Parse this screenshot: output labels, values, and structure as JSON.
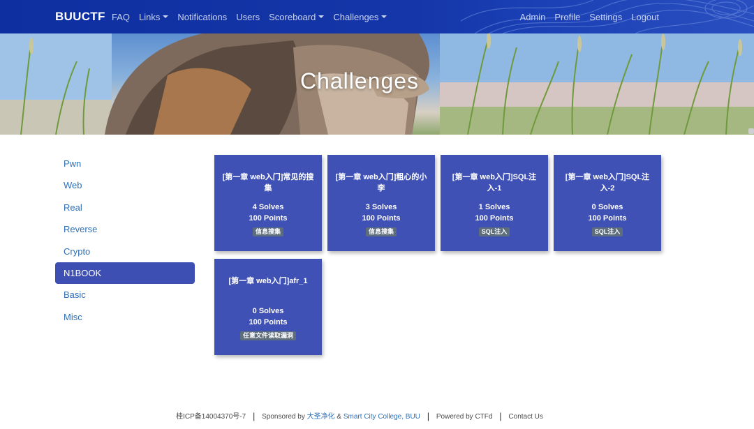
{
  "brand": "BUUCTF",
  "nav_left": [
    {
      "label": "FAQ",
      "dropdown": false
    },
    {
      "label": "Links",
      "dropdown": true
    },
    {
      "label": "Notifications",
      "dropdown": false
    },
    {
      "label": "Users",
      "dropdown": false
    },
    {
      "label": "Scoreboard",
      "dropdown": true
    },
    {
      "label": "Challenges",
      "dropdown": true
    }
  ],
  "nav_right": [
    "Admin",
    "Profile",
    "Settings",
    "Logout"
  ],
  "hero_title": "Challenges",
  "categories": [
    "Pwn",
    "Web",
    "Real",
    "Reverse",
    "Crypto",
    "N1BOOK",
    "Basic",
    "Misc"
  ],
  "active_category": "N1BOOK",
  "challenges": [
    {
      "name": "[第一章 web入门]常见的搜集",
      "solves": "4 Solves",
      "points": "100 Points",
      "tag": "信息搜集"
    },
    {
      "name": "[第一章 web入门]粗心的小李",
      "solves": "3 Solves",
      "points": "100 Points",
      "tag": "信息搜集"
    },
    {
      "name": "[第一章 web入门]SQL注入-1",
      "solves": "1 Solves",
      "points": "100 Points",
      "tag": "SQL注入"
    },
    {
      "name": "[第一章 web入门]SQL注入-2",
      "solves": "0 Solves",
      "points": "100 Points",
      "tag": "SQL注入"
    },
    {
      "name": "[第一章 web入门]afr_1",
      "solves": "0 Solves",
      "points": "100 Points",
      "tag": "任意文件读取漏洞"
    }
  ],
  "footer": {
    "icp": "桂ICP备14004370号-7",
    "sponsored_prefix": "Sponsored by",
    "sponsor1": "大圣净化",
    "amp": "&",
    "sponsor2": "Smart City College, BUU",
    "powered": "Powered by CTFd",
    "contact": "Contact Us"
  },
  "colors": {
    "navbar": "#1436a8",
    "card": "#3f51b5",
    "active_category": "#3d4fb3",
    "link": "#2c6fb7",
    "tag": "#5d6d7c"
  }
}
